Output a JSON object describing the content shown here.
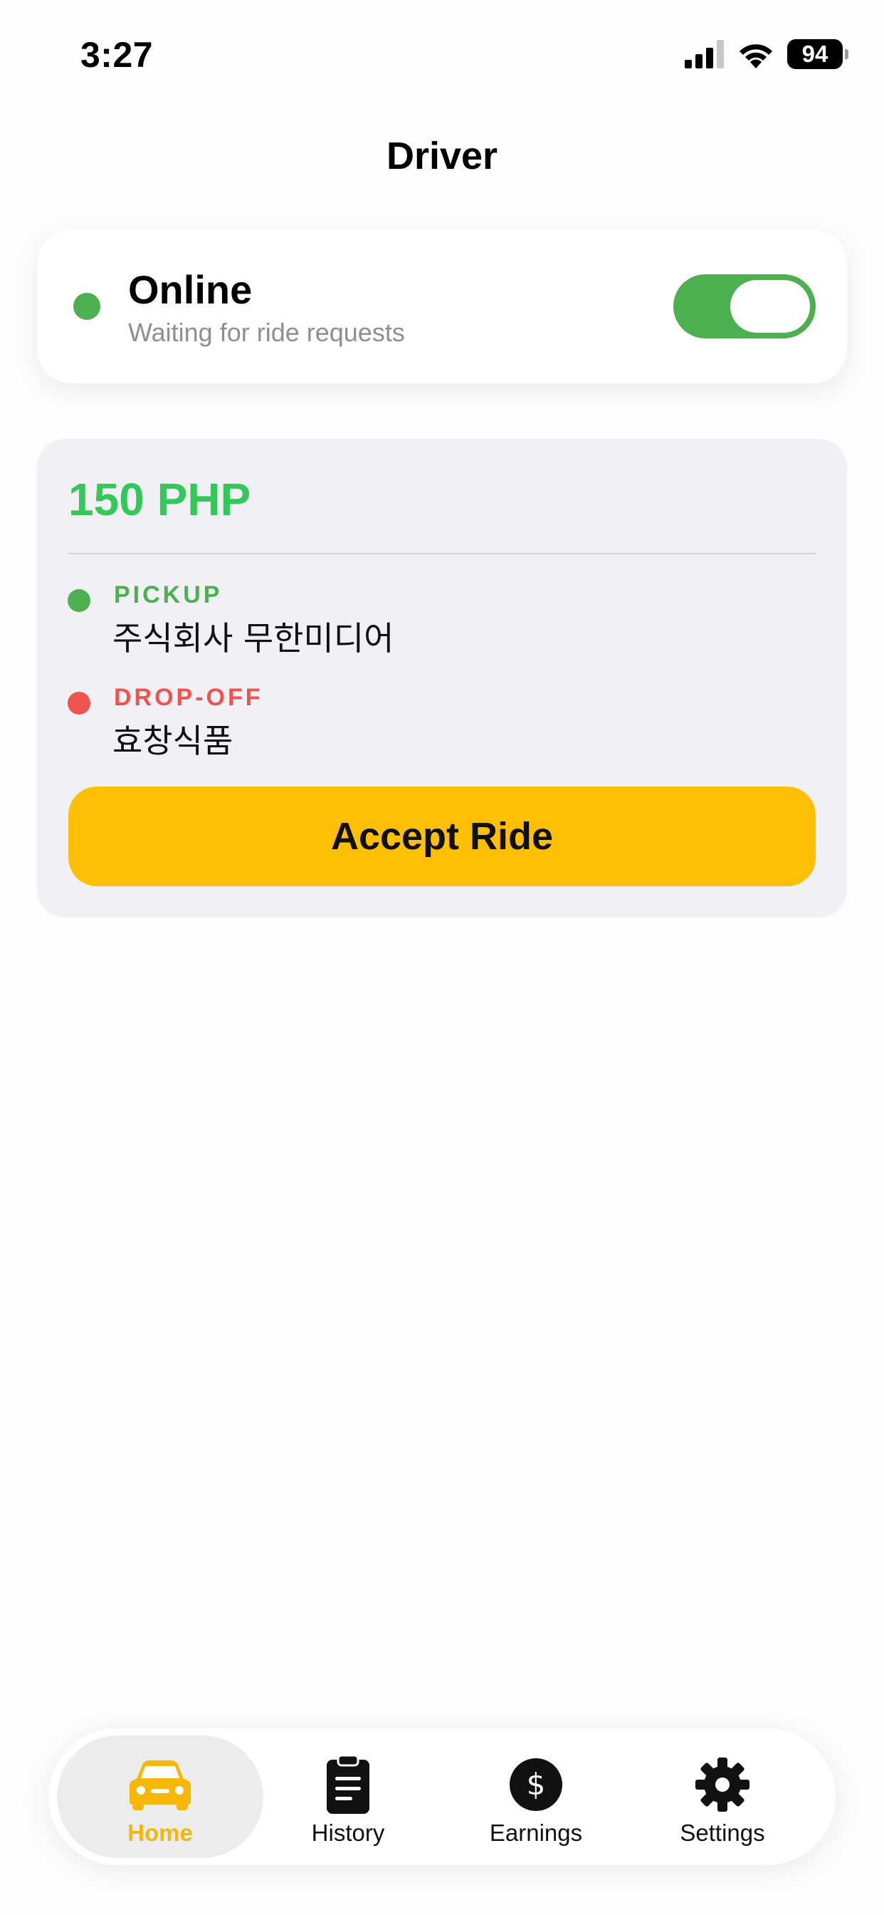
{
  "status_bar": {
    "time": "3:27",
    "battery": "94"
  },
  "header": {
    "title": "Driver"
  },
  "status_card": {
    "title": "Online",
    "subtitle": "Waiting for ride requests",
    "toggle_on": true,
    "colors": {
      "dot": "#4caf50",
      "toggle": "#4caf50"
    }
  },
  "ride_request": {
    "fare": "150 PHP",
    "pickup": {
      "label": "PICKUP",
      "value": "주식회사 무한미디어"
    },
    "dropoff": {
      "label": "DROP-OFF",
      "value": "효창식품"
    },
    "accept_label": "Accept Ride",
    "colors": {
      "fare": "#34c759",
      "pickup": "#4caf50",
      "dropoff": "#ef5350",
      "button": "#fec007"
    }
  },
  "tab_bar": {
    "active": "Home",
    "items": [
      {
        "label": "Home",
        "icon": "car-icon"
      },
      {
        "label": "History",
        "icon": "clipboard-icon"
      },
      {
        "label": "Earnings",
        "icon": "dollar-icon"
      },
      {
        "label": "Settings",
        "icon": "gear-icon"
      }
    ],
    "active_color": "#f5b70a"
  }
}
